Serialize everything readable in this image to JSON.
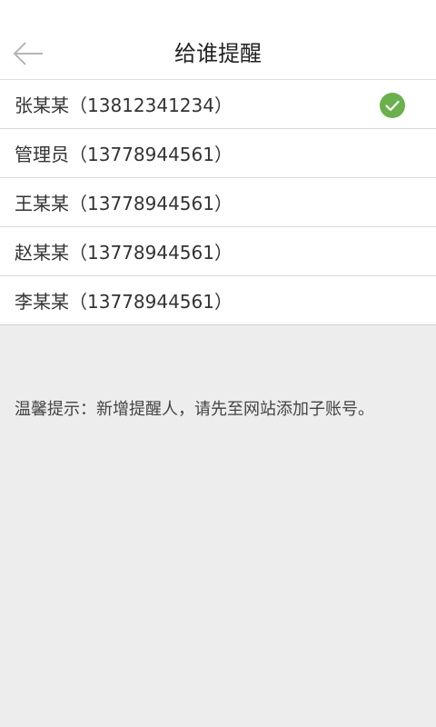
{
  "header": {
    "title": "给谁提醒",
    "back_icon": "arrow-left-icon"
  },
  "recipients": [
    {
      "label": "张某某（13812341234）",
      "selected": true
    },
    {
      "label": "管理员（13778944561）",
      "selected": false
    },
    {
      "label": "王某某（13778944561）",
      "selected": false
    },
    {
      "label": "赵某某（13778944561）",
      "selected": false
    },
    {
      "label": "李某某（13778944561）",
      "selected": false
    }
  ],
  "tip": "温馨提示：新增提醒人，请先至网站添加子账号。",
  "colors": {
    "check": "#6ab04c",
    "background": "#ededed"
  }
}
